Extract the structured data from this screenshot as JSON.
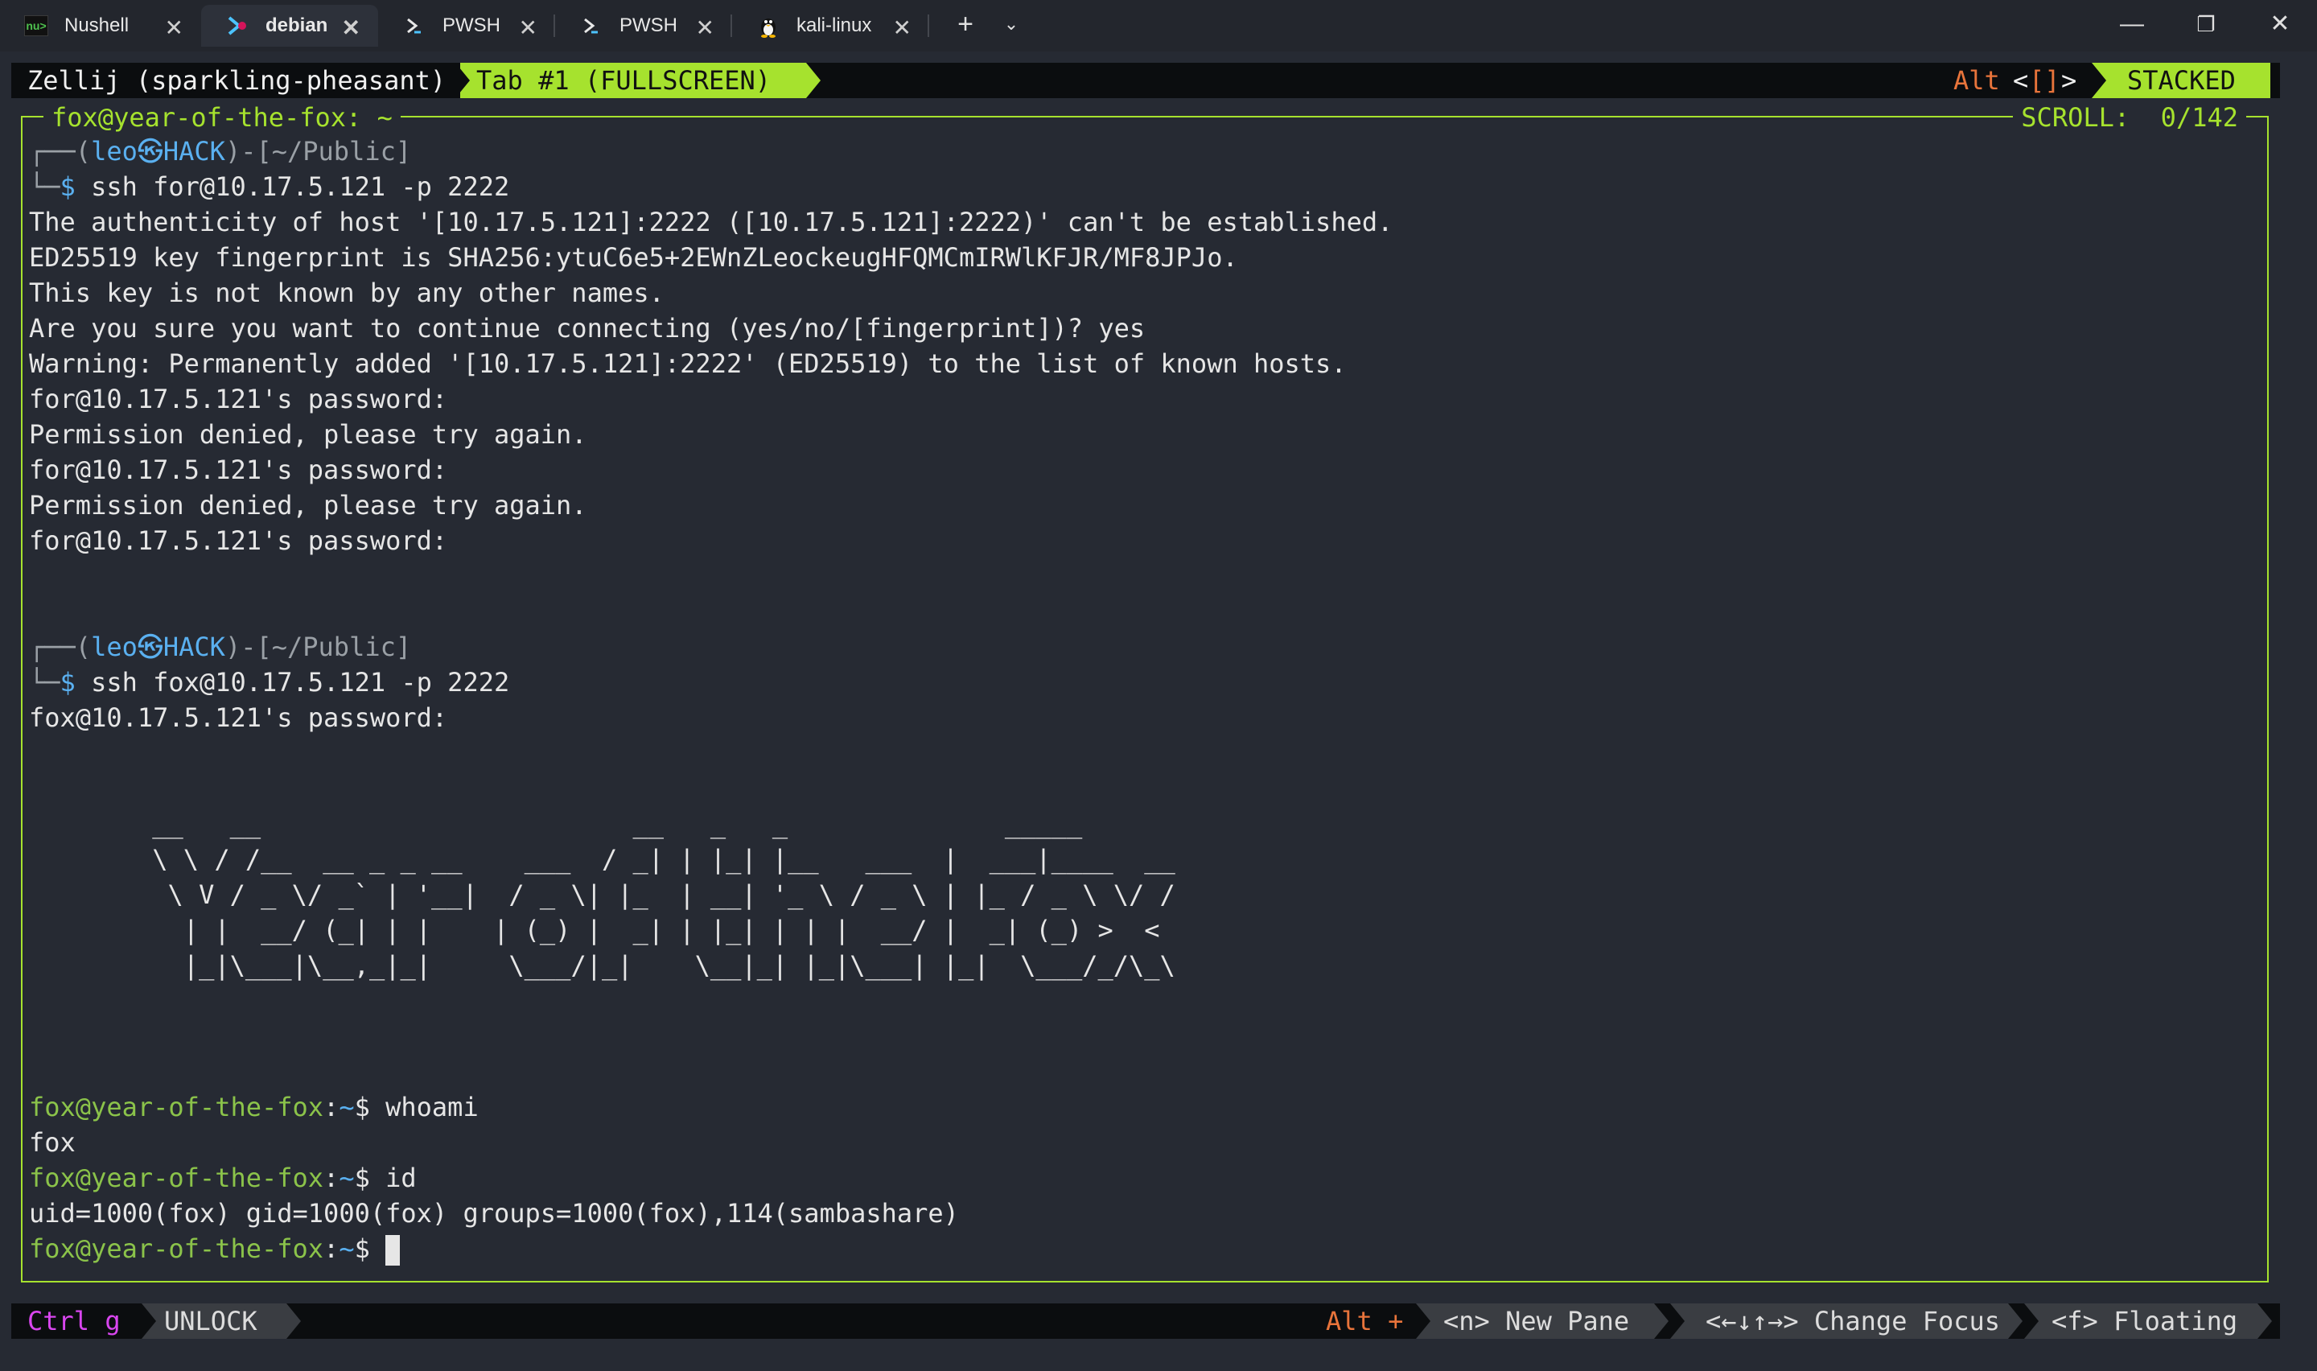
{
  "tabs": [
    {
      "label": "Nushell",
      "icon": "nushell-icon"
    },
    {
      "label": "debian",
      "icon": "debian-icon",
      "active": true
    },
    {
      "label": "PWSH",
      "icon": "powershell-icon"
    },
    {
      "label": "PWSH",
      "icon": "powershell-icon"
    },
    {
      "label": "kali-linux",
      "icon": "linux-penguin-icon"
    }
  ],
  "window": {
    "minimize": "—",
    "maximize": "❐",
    "close": "✕",
    "new_tab": "+",
    "dropdown": "⌄"
  },
  "zellij_top": {
    "session": "Zellij (sparkling-pheasant)",
    "tab": "Tab #1 (FULLSCREEN)",
    "alt_label": "Alt",
    "alt_keys_open": "<",
    "alt_keys_mid": "[]",
    "alt_keys_close": ">",
    "mode": "STACKED"
  },
  "pane": {
    "title": "fox@year-of-the-fox: ~",
    "scroll_label": "SCROLL:",
    "scroll_value": "0/142"
  },
  "terminal": {
    "prompt1": {
      "top": "┌──(",
      "user": "leo",
      "skull": "㉿",
      "host": "HACK",
      "path": ")-[~/Public]",
      "bottom": "└─",
      "dollar": "$",
      "cmd": " ssh for@10.17.5.121 -p 2222"
    },
    "out1": [
      "The authenticity of host '[10.17.5.121]:2222 ([10.17.5.121]:2222)' can't be established.",
      "ED25519 key fingerprint is SHA256:ytuC6e5+2EWnZLeockeugHFQMCmIRWlKFJR/MF8JPJo.",
      "This key is not known by any other names.",
      "Are you sure you want to continue connecting (yes/no/[fingerprint])? yes",
      "Warning: Permanently added '[10.17.5.121]:2222' (ED25519) to the list of known hosts.",
      "for@10.17.5.121's password:",
      "Permission denied, please try again.",
      "for@10.17.5.121's password:",
      "Permission denied, please try again.",
      "for@10.17.5.121's password:"
    ],
    "prompt2": {
      "top": "┌──(",
      "user": "leo",
      "skull": "㉿",
      "host": "HACK",
      "path": ")-[~/Public]",
      "bottom": "└─",
      "dollar": "$",
      "cmd": " ssh fox@10.17.5.121 -p 2222"
    },
    "out2": "fox@10.17.5.121's password:",
    "banner": [
      " __   __                        __   _   _              _____",
      " \\ \\ / /__  __ _ _ __    ___  / _| | |_| |__   ___  |  ___|____  __",
      "  \\ V / _ \\/ _` | '__|  / _ \\| |_  | __| '_ \\ / _ \\ | |_ / _ \\ \\/ /",
      "   | |  __/ (_| | |    | (_) |  _| | |_| | | |  __/ |  _| (_) >  <",
      "   |_|\\___|\\__,_|_|     \\___/|_|    \\__|_| |_|\\___| |_|  \\___/_/\\_\\"
    ],
    "session": [
      {
        "user": "fox@year-of-the-fox",
        "sep": ":",
        "path": "~",
        "dollar": "$",
        "cmd": " whoami"
      },
      {
        "output": "fox"
      },
      {
        "user": "fox@year-of-the-fox",
        "sep": ":",
        "path": "~",
        "dollar": "$",
        "cmd": " id"
      },
      {
        "output": "uid=1000(fox) gid=1000(fox) groups=1000(fox),114(sambashare)"
      },
      {
        "user": "fox@year-of-the-fox",
        "sep": ":",
        "path": "~",
        "dollar": "$",
        "cmd": " "
      }
    ]
  },
  "zellij_bottom": {
    "ctrl": "Ctrl g",
    "unlock": "UNLOCK",
    "alt": "Alt +",
    "new_pane": "<n> New Pane",
    "change_focus": "<←↓↑→> Change Focus",
    "floating": "<f> Floating"
  },
  "colors": {
    "accent": "#a6e22e",
    "orange": "#e8743b",
    "magenta": "#d946ef",
    "blue": "#5ab0f0",
    "bg": "#262a33"
  }
}
